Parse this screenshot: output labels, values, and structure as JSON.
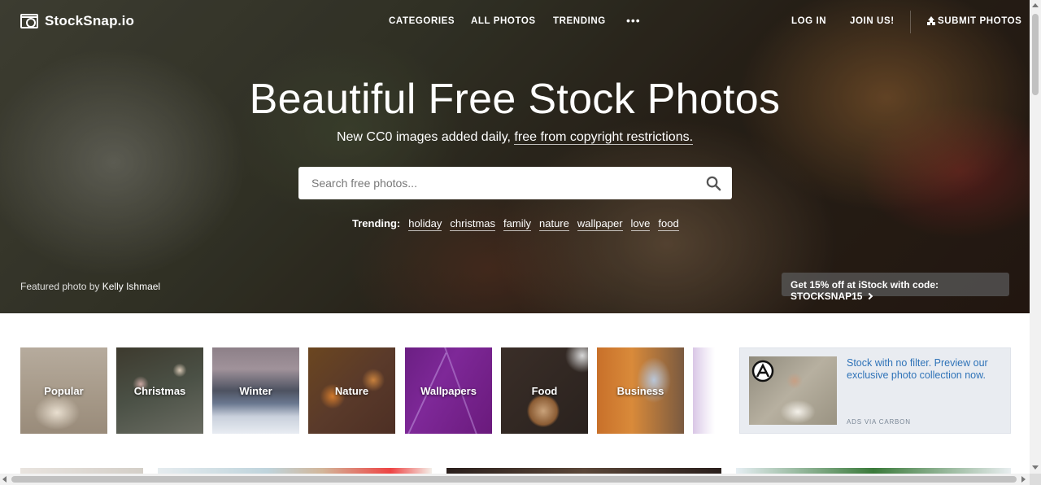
{
  "header": {
    "logo_text": "StockSnap.io",
    "nav": {
      "categories": "CATEGORIES",
      "all_photos": "ALL PHOTOS",
      "trending": "TRENDING",
      "more": "•••",
      "login": "LOG IN",
      "join": "JOIN US!",
      "submit": "SUBMIT PHOTOS"
    }
  },
  "hero": {
    "title": "Beautiful Free Stock Photos",
    "subtitle_prefix": "New CC0 images added daily, ",
    "subtitle_link": "free from copyright restrictions.",
    "search_placeholder": "Search free photos...",
    "trending_label": "Trending:",
    "trending_tags": [
      "holiday",
      "christmas",
      "family",
      "nature",
      "wallpaper",
      "love",
      "food"
    ],
    "featured_prefix": "Featured photo by ",
    "featured_author": "Kelly Ishmael",
    "promo": "Get 15% off at iStock with code: STOCKSNAP15"
  },
  "categories": [
    "Popular",
    "Christmas",
    "Winter",
    "Nature",
    "Wallpapers",
    "Food",
    "Business"
  ],
  "ad": {
    "text": "Stock with no filter. Preview our exclusive photo collection now.",
    "via": "ADS VIA CARBON"
  },
  "colors": {
    "link_blue": "#2f73b8",
    "ad_background": "#e9ecf1",
    "wallpapers_purple": "#6b1f83"
  },
  "icons": {
    "logo": "camera-icon",
    "search": "search-icon",
    "upload": "upload-icon",
    "promo": "chevron-right-icon",
    "ad_logo": "carbon-logo-icon"
  }
}
